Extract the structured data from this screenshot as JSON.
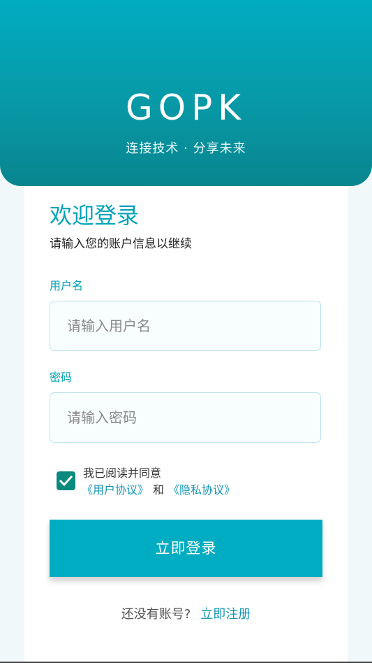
{
  "header": {
    "logo": "GOPK",
    "slogan": "连接技术 · 分享未来"
  },
  "welcome": {
    "title": "欢迎登录",
    "subtitle": "请输入您的账户信息以继续"
  },
  "form": {
    "username_label": "用户名",
    "username_placeholder": "请输入用户名",
    "username_value": "",
    "password_label": "密码",
    "password_placeholder": "请输入密码",
    "password_value": ""
  },
  "agreement": {
    "checked": true,
    "text": "我已阅读并同意",
    "user_agreement": "《用户协议》",
    "and": "和",
    "privacy_policy": "《隐私协议》"
  },
  "login_button": "立即登录",
  "register": {
    "question": "还没有账号?",
    "link": "立即注册"
  },
  "colors": {
    "accent": "#00acc1",
    "checkbox": "#0a8a7e",
    "link": "#1496b5"
  }
}
